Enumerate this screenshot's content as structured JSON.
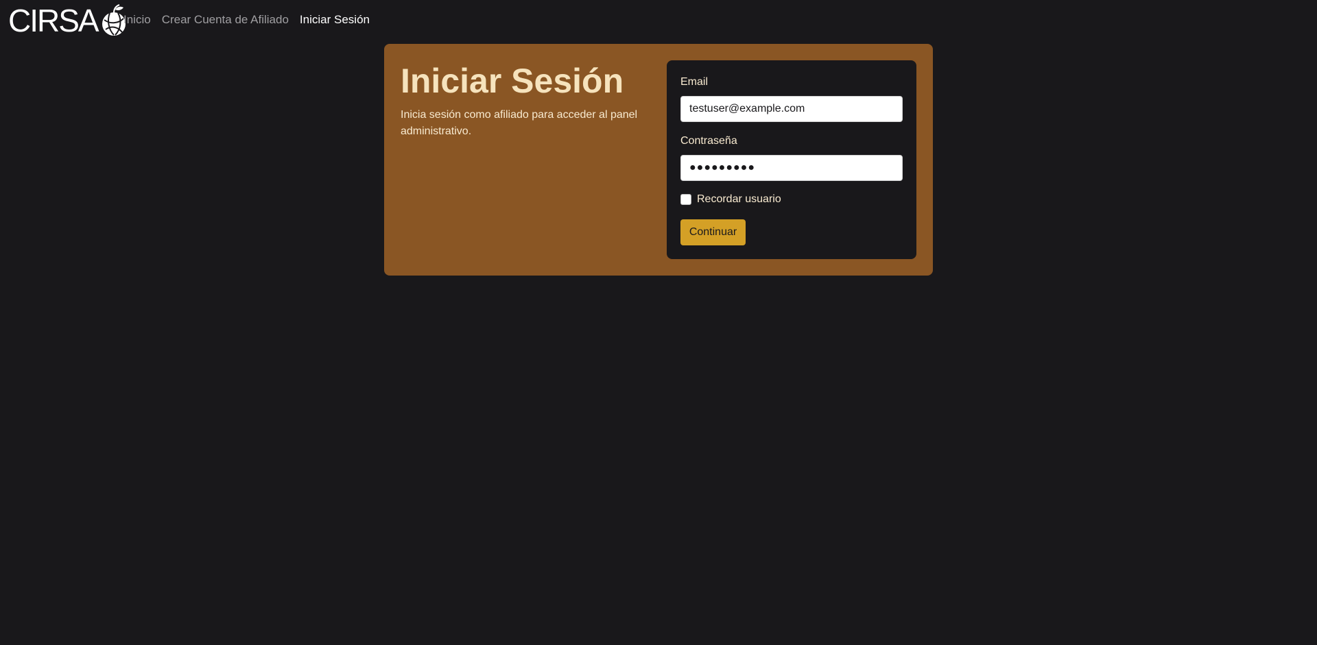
{
  "brand": {
    "name": "CIRSA",
    "logo_icon": "apple-globe-icon"
  },
  "nav": {
    "items": [
      {
        "label": "Inicio",
        "active": false
      },
      {
        "label": "Crear Cuenta de Afiliado",
        "active": false
      },
      {
        "label": "Iniciar Sesión",
        "active": true
      }
    ]
  },
  "intro": {
    "title": "Iniciar Sesión",
    "description": "Inicia sesión como afiliado para acceder al panel administrativo."
  },
  "form": {
    "email_label": "Email",
    "email_value": "testuser@example.com",
    "password_label": "Contraseña",
    "password_value": "●●●●●●●●●",
    "remember_label": "Recordar usuario",
    "remember_checked": false,
    "submit_label": "Continuar"
  },
  "colors": {
    "background": "#19181b",
    "card": "#8a5624",
    "accent": "#d4a026",
    "title_text": "#f6e3bd"
  }
}
